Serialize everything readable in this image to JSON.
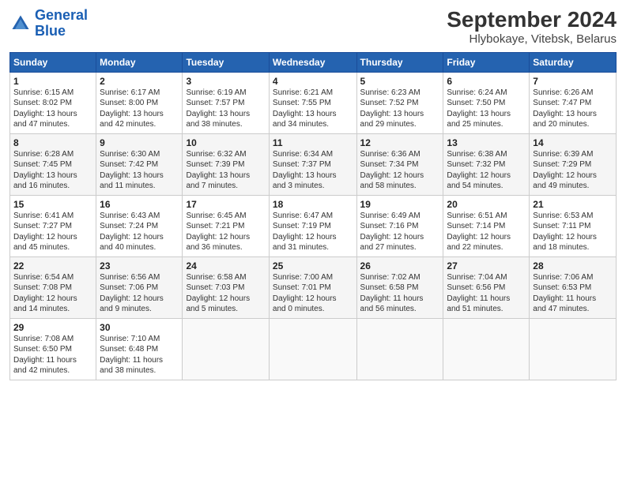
{
  "header": {
    "logo_line1": "General",
    "logo_line2": "Blue",
    "title": "September 2024",
    "subtitle": "Hlybokaye, Vitebsk, Belarus"
  },
  "calendar": {
    "days_of_week": [
      "Sunday",
      "Monday",
      "Tuesday",
      "Wednesday",
      "Thursday",
      "Friday",
      "Saturday"
    ],
    "weeks": [
      [
        {
          "day": "1",
          "info": "Sunrise: 6:15 AM\nSunset: 8:02 PM\nDaylight: 13 hours\nand 47 minutes."
        },
        {
          "day": "2",
          "info": "Sunrise: 6:17 AM\nSunset: 8:00 PM\nDaylight: 13 hours\nand 42 minutes."
        },
        {
          "day": "3",
          "info": "Sunrise: 6:19 AM\nSunset: 7:57 PM\nDaylight: 13 hours\nand 38 minutes."
        },
        {
          "day": "4",
          "info": "Sunrise: 6:21 AM\nSunset: 7:55 PM\nDaylight: 13 hours\nand 34 minutes."
        },
        {
          "day": "5",
          "info": "Sunrise: 6:23 AM\nSunset: 7:52 PM\nDaylight: 13 hours\nand 29 minutes."
        },
        {
          "day": "6",
          "info": "Sunrise: 6:24 AM\nSunset: 7:50 PM\nDaylight: 13 hours\nand 25 minutes."
        },
        {
          "day": "7",
          "info": "Sunrise: 6:26 AM\nSunset: 7:47 PM\nDaylight: 13 hours\nand 20 minutes."
        }
      ],
      [
        {
          "day": "8",
          "info": "Sunrise: 6:28 AM\nSunset: 7:45 PM\nDaylight: 13 hours\nand 16 minutes."
        },
        {
          "day": "9",
          "info": "Sunrise: 6:30 AM\nSunset: 7:42 PM\nDaylight: 13 hours\nand 11 minutes."
        },
        {
          "day": "10",
          "info": "Sunrise: 6:32 AM\nSunset: 7:39 PM\nDaylight: 13 hours\nand 7 minutes."
        },
        {
          "day": "11",
          "info": "Sunrise: 6:34 AM\nSunset: 7:37 PM\nDaylight: 13 hours\nand 3 minutes."
        },
        {
          "day": "12",
          "info": "Sunrise: 6:36 AM\nSunset: 7:34 PM\nDaylight: 12 hours\nand 58 minutes."
        },
        {
          "day": "13",
          "info": "Sunrise: 6:38 AM\nSunset: 7:32 PM\nDaylight: 12 hours\nand 54 minutes."
        },
        {
          "day": "14",
          "info": "Sunrise: 6:39 AM\nSunset: 7:29 PM\nDaylight: 12 hours\nand 49 minutes."
        }
      ],
      [
        {
          "day": "15",
          "info": "Sunrise: 6:41 AM\nSunset: 7:27 PM\nDaylight: 12 hours\nand 45 minutes."
        },
        {
          "day": "16",
          "info": "Sunrise: 6:43 AM\nSunset: 7:24 PM\nDaylight: 12 hours\nand 40 minutes."
        },
        {
          "day": "17",
          "info": "Sunrise: 6:45 AM\nSunset: 7:21 PM\nDaylight: 12 hours\nand 36 minutes."
        },
        {
          "day": "18",
          "info": "Sunrise: 6:47 AM\nSunset: 7:19 PM\nDaylight: 12 hours\nand 31 minutes."
        },
        {
          "day": "19",
          "info": "Sunrise: 6:49 AM\nSunset: 7:16 PM\nDaylight: 12 hours\nand 27 minutes."
        },
        {
          "day": "20",
          "info": "Sunrise: 6:51 AM\nSunset: 7:14 PM\nDaylight: 12 hours\nand 22 minutes."
        },
        {
          "day": "21",
          "info": "Sunrise: 6:53 AM\nSunset: 7:11 PM\nDaylight: 12 hours\nand 18 minutes."
        }
      ],
      [
        {
          "day": "22",
          "info": "Sunrise: 6:54 AM\nSunset: 7:08 PM\nDaylight: 12 hours\nand 14 minutes."
        },
        {
          "day": "23",
          "info": "Sunrise: 6:56 AM\nSunset: 7:06 PM\nDaylight: 12 hours\nand 9 minutes."
        },
        {
          "day": "24",
          "info": "Sunrise: 6:58 AM\nSunset: 7:03 PM\nDaylight: 12 hours\nand 5 minutes."
        },
        {
          "day": "25",
          "info": "Sunrise: 7:00 AM\nSunset: 7:01 PM\nDaylight: 12 hours\nand 0 minutes."
        },
        {
          "day": "26",
          "info": "Sunrise: 7:02 AM\nSunset: 6:58 PM\nDaylight: 11 hours\nand 56 minutes."
        },
        {
          "day": "27",
          "info": "Sunrise: 7:04 AM\nSunset: 6:56 PM\nDaylight: 11 hours\nand 51 minutes."
        },
        {
          "day": "28",
          "info": "Sunrise: 7:06 AM\nSunset: 6:53 PM\nDaylight: 11 hours\nand 47 minutes."
        }
      ],
      [
        {
          "day": "29",
          "info": "Sunrise: 7:08 AM\nSunset: 6:50 PM\nDaylight: 11 hours\nand 42 minutes."
        },
        {
          "day": "30",
          "info": "Sunrise: 7:10 AM\nSunset: 6:48 PM\nDaylight: 11 hours\nand 38 minutes."
        },
        {
          "day": "",
          "info": ""
        },
        {
          "day": "",
          "info": ""
        },
        {
          "day": "",
          "info": ""
        },
        {
          "day": "",
          "info": ""
        },
        {
          "day": "",
          "info": ""
        }
      ]
    ]
  }
}
